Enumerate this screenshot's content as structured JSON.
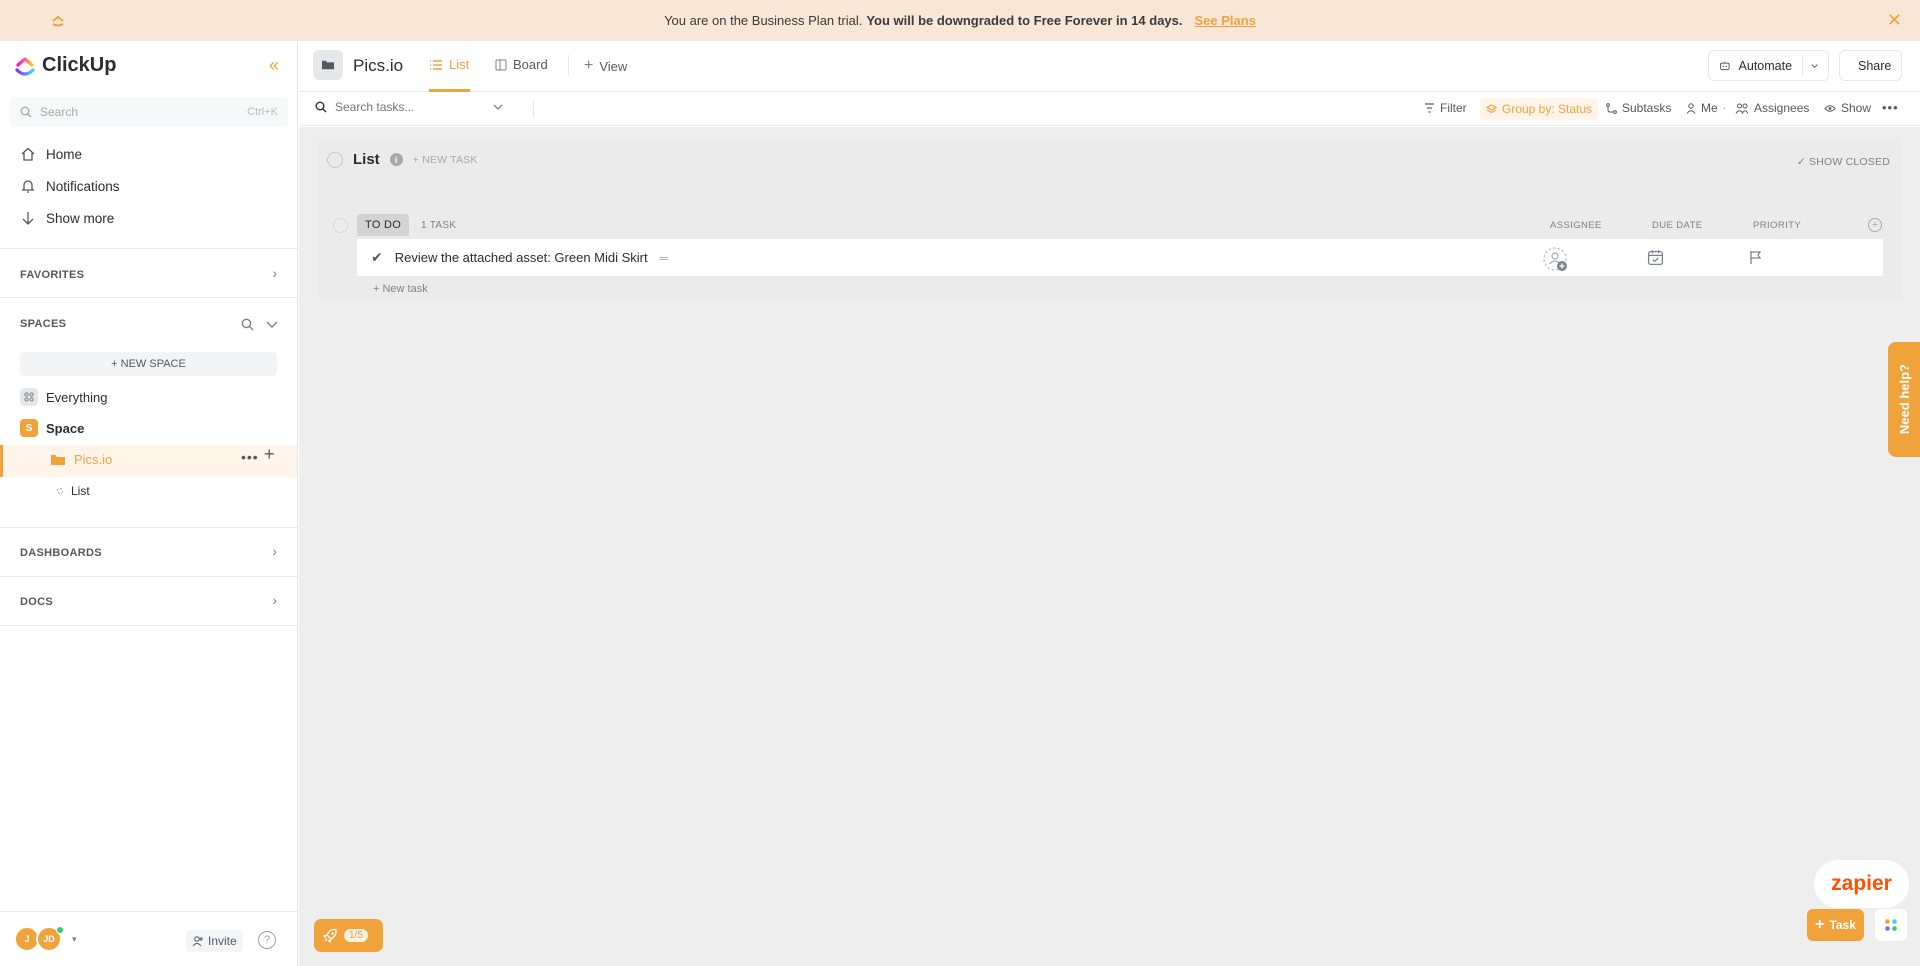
{
  "banner": {
    "text": "You are on the Business Plan trial.",
    "bold": "You will be downgraded to Free Forever in 14 days.",
    "link": "See Plans"
  },
  "sidebar": {
    "brand": "ClickUp",
    "search_placeholder": "Search",
    "search_shortcut": "Ctrl+K",
    "nav": [
      {
        "label": "Home",
        "icon": "home-icon"
      },
      {
        "label": "Notifications",
        "icon": "bell-icon"
      },
      {
        "label": "Show more",
        "icon": "arrow-down-icon"
      }
    ],
    "favorites": "FAVORITES",
    "spaces": "SPACES",
    "new_space": "+ NEW SPACE",
    "everything": "Everything",
    "space": {
      "label": "Space",
      "initial": "S"
    },
    "folder": "Pics.io",
    "list": "List",
    "dashboards": "DASHBOARDS",
    "docs": "DOCS",
    "footer": {
      "avatar1": "J",
      "avatar2": "JD",
      "invite": "Invite"
    }
  },
  "topbar": {
    "title": "Pics.io",
    "tabs": [
      {
        "label": "List",
        "active": true
      },
      {
        "label": "Board",
        "active": false
      },
      {
        "label": "View",
        "active": false
      }
    ],
    "automate": "Automate",
    "share": "Share"
  },
  "toolbar": {
    "search_placeholder": "Search tasks...",
    "filter": "Filter",
    "group_by": "Group by: Status",
    "subtasks": "Subtasks",
    "me": "Me",
    "assignees": "Assignees",
    "show": "Show"
  },
  "list": {
    "title": "List",
    "new_task_header": "+ NEW TASK",
    "show_closed": "SHOW CLOSED",
    "group": {
      "status": "TO DO",
      "count": "1 TASK"
    },
    "columns": [
      "ASSIGNEE",
      "DUE DATE",
      "PRIORITY"
    ],
    "tasks": [
      {
        "name": "Review the attached asset: Green Midi Skirt"
      }
    ],
    "new_task_link": "+ New task"
  },
  "widgets": {
    "onboarding_progress": "1/5",
    "need_help": "Need help?",
    "zapier": "zapier",
    "task_fab": "Task"
  },
  "colors": {
    "accent": "#f0a23b",
    "banner_bg": "#f8e7d6",
    "main_bg": "#eeeeee"
  }
}
